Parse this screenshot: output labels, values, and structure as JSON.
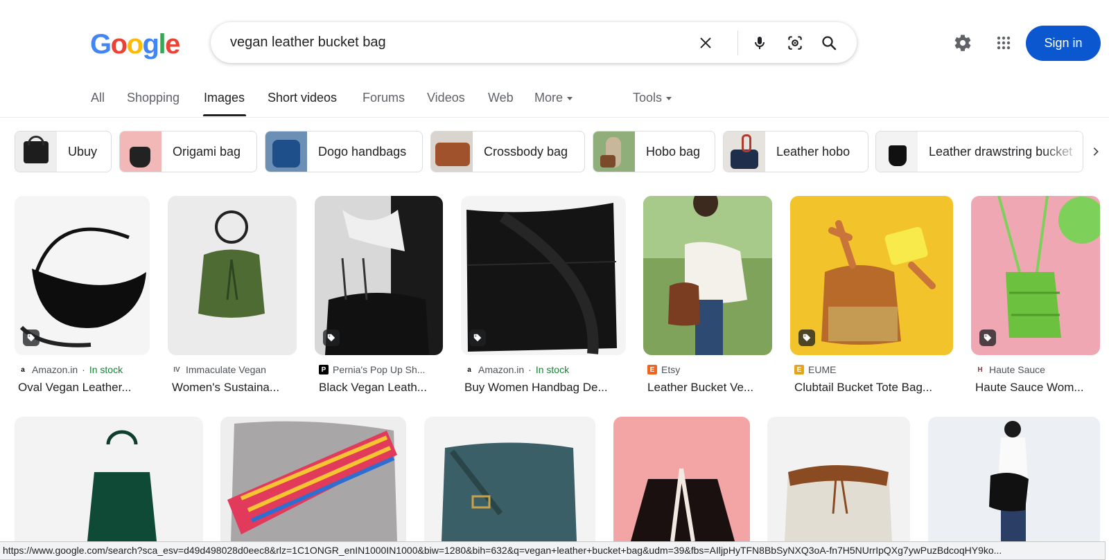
{
  "logo": {
    "letters": [
      "G",
      "o",
      "o",
      "g",
      "l",
      "e"
    ],
    "colors": [
      "#4285f4",
      "#ea4335",
      "#fbbc05",
      "#4285f4",
      "#34a853",
      "#ea4335"
    ]
  },
  "search": {
    "query": "vegan leather bucket bag",
    "icons": [
      "clear-icon",
      "microphone-icon",
      "lens-icon",
      "search-icon"
    ]
  },
  "header": {
    "settings_icon": "gear-icon",
    "apps_icon": "apps-grid-icon",
    "signin_label": "Sign in",
    "accent": "#0b57d0"
  },
  "tabs": [
    {
      "label": "All"
    },
    {
      "label": "Shopping"
    },
    {
      "label": "Images"
    },
    {
      "label": "Short videos"
    },
    {
      "label": "Forums"
    },
    {
      "label": "Videos"
    },
    {
      "label": "Web"
    },
    {
      "label": "More"
    },
    {
      "label": "Tools"
    }
  ],
  "chips": [
    {
      "label": "Ubuy"
    },
    {
      "label": "Origami bag"
    },
    {
      "label": "Dogo handbags"
    },
    {
      "label": "Crossbody bag"
    },
    {
      "label": "Hobo bag"
    },
    {
      "label": "Leather hobo"
    },
    {
      "label": "Leather drawstring bucket"
    }
  ],
  "results_row1": [
    {
      "source": "Amazon.in",
      "stock": "In stock",
      "title": "Oval Vegan Leather...",
      "favicon": "a",
      "fav_color": "#000000"
    },
    {
      "source": "Immaculate Vegan",
      "stock": "",
      "title": "Women's Sustaina...",
      "favicon": "IV",
      "fav_color": "#5f6368"
    },
    {
      "source": "Pernia's Pop Up Sh...",
      "stock": "",
      "title": "Black Vegan Leath...",
      "favicon": "P",
      "fav_color": "#000000"
    },
    {
      "source": "Amazon.in",
      "stock": "In stock",
      "title": "Buy Women Handbag De...",
      "favicon": "a",
      "fav_color": "#000000"
    },
    {
      "source": "Etsy",
      "stock": "",
      "title": "Leather Bucket Ve...",
      "favicon": "E",
      "fav_color": "#f1641e"
    },
    {
      "source": "EUME",
      "stock": "",
      "title": "Clubtail Bucket Tote Bag...",
      "favicon": "E",
      "fav_color": "#e8a317"
    },
    {
      "source": "Haute Sauce",
      "stock": "",
      "title": "Haute Sauce Wom...",
      "favicon": "H",
      "fav_color": "#8b3a4a"
    }
  ],
  "status_url": "https://www.google.com/search?sca_esv=d49d498028d0eec8&rlz=1C1ONGR_enIN1000IN1000&biw=1280&bih=632&q=vegan+leather+bucket+bag&udm=39&fbs=AIljpHyTFN8BbSyNXQ3oA-fn7H5NUrrIpQXg7ywPuzBdcoqHY9ko..."
}
